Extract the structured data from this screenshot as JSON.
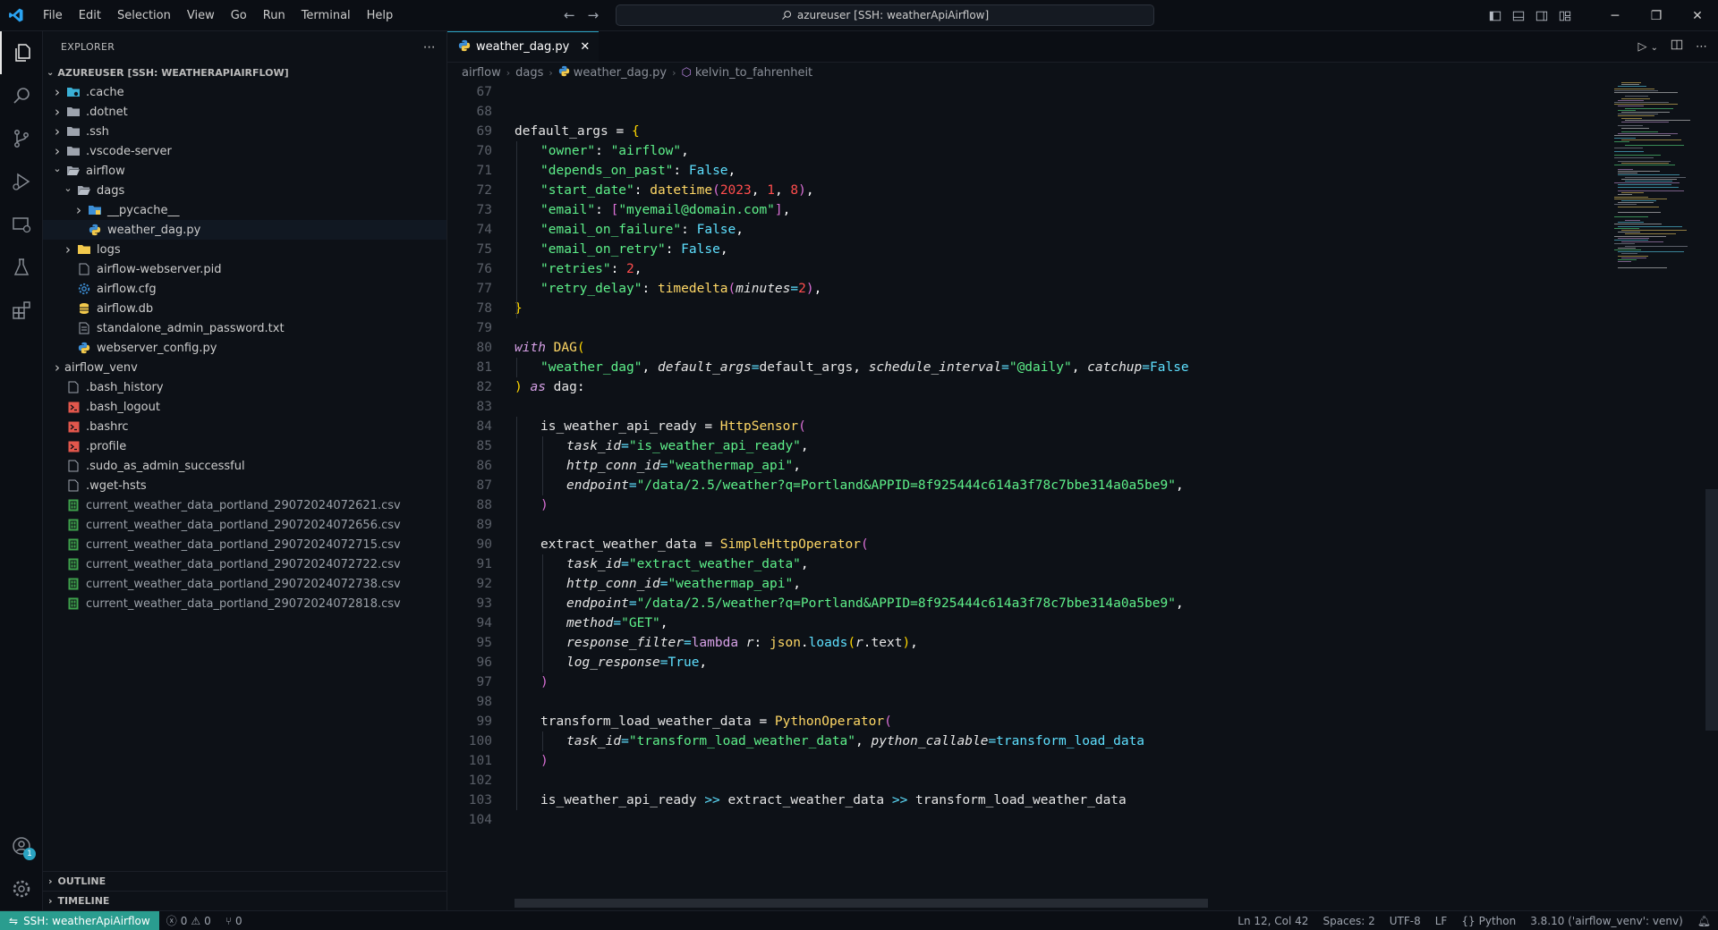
{
  "menu": [
    "File",
    "Edit",
    "Selection",
    "View",
    "Go",
    "Run",
    "Terminal",
    "Help"
  ],
  "search": {
    "text": "azureuser [SSH: weatherApiAirflow]"
  },
  "explorer": {
    "title": "EXPLORER",
    "root": "AZUREUSER [SSH: WEATHERAPIAIRFLOW]",
    "items": [
      {
        "label": ".cache",
        "depth": 1,
        "type": "folder",
        "chev": "right",
        "icon": "folder-cache-icon"
      },
      {
        "label": ".dotnet",
        "depth": 1,
        "type": "folder",
        "chev": "right",
        "icon": "folder-icon"
      },
      {
        "label": ".ssh",
        "depth": 1,
        "type": "folder",
        "chev": "right",
        "icon": "folder-icon"
      },
      {
        "label": ".vscode-server",
        "depth": 1,
        "type": "folder",
        "chev": "right",
        "icon": "folder-icon"
      },
      {
        "label": "airflow",
        "depth": 1,
        "type": "folder",
        "chev": "down",
        "icon": "folder-open-icon"
      },
      {
        "label": "dags",
        "depth": 2,
        "type": "folder",
        "chev": "down",
        "icon": "folder-open-icon"
      },
      {
        "label": "__pycache__",
        "depth": 3,
        "type": "folder",
        "chev": "right",
        "icon": "folder-python-icon"
      },
      {
        "label": "weather_dag.py",
        "depth": 3,
        "type": "file",
        "chev": "",
        "icon": "python-file-icon",
        "selected": true
      },
      {
        "label": "logs",
        "depth": 2,
        "type": "folder",
        "chev": "right",
        "icon": "folder-logs-icon"
      },
      {
        "label": "airflow-webserver.pid",
        "depth": 2,
        "type": "file",
        "chev": "",
        "icon": "file-icon"
      },
      {
        "label": "airflow.cfg",
        "depth": 2,
        "type": "file",
        "chev": "",
        "icon": "gear-file-icon"
      },
      {
        "label": "airflow.db",
        "depth": 2,
        "type": "file",
        "chev": "",
        "icon": "database-icon"
      },
      {
        "label": "standalone_admin_password.txt",
        "depth": 2,
        "type": "file",
        "chev": "",
        "icon": "text-file-icon"
      },
      {
        "label": "webserver_config.py",
        "depth": 2,
        "type": "file",
        "chev": "",
        "icon": "python-file-icon"
      },
      {
        "label": "airflow_venv",
        "depth": 1,
        "type": "folder",
        "chev": "right",
        "icon": ""
      },
      {
        "label": ".bash_history",
        "depth": 1,
        "type": "file",
        "chev": "",
        "icon": "file-icon"
      },
      {
        "label": ".bash_logout",
        "depth": 1,
        "type": "file",
        "chev": "",
        "icon": "shell-file-icon"
      },
      {
        "label": ".bashrc",
        "depth": 1,
        "type": "file",
        "chev": "",
        "icon": "shell-file-icon"
      },
      {
        "label": ".profile",
        "depth": 1,
        "type": "file",
        "chev": "",
        "icon": "shell-file-icon"
      },
      {
        "label": ".sudo_as_admin_successful",
        "depth": 1,
        "type": "file",
        "chev": "",
        "icon": "file-icon"
      },
      {
        "label": ".wget-hsts",
        "depth": 1,
        "type": "file",
        "chev": "",
        "icon": "file-icon"
      },
      {
        "label": "current_weather_data_portland_29072024072621.csv",
        "depth": 1,
        "type": "file",
        "chev": "",
        "icon": "csv-file-icon"
      },
      {
        "label": "current_weather_data_portland_29072024072656.csv",
        "depth": 1,
        "type": "file",
        "chev": "",
        "icon": "csv-file-icon"
      },
      {
        "label": "current_weather_data_portland_29072024072715.csv",
        "depth": 1,
        "type": "file",
        "chev": "",
        "icon": "csv-file-icon"
      },
      {
        "label": "current_weather_data_portland_29072024072722.csv",
        "depth": 1,
        "type": "file",
        "chev": "",
        "icon": "csv-file-icon"
      },
      {
        "label": "current_weather_data_portland_29072024072738.csv",
        "depth": 1,
        "type": "file",
        "chev": "",
        "icon": "csv-file-icon"
      },
      {
        "label": "current_weather_data_portland_29072024072818.csv",
        "depth": 1,
        "type": "file",
        "chev": "",
        "icon": "csv-file-icon"
      }
    ],
    "panels": [
      "OUTLINE",
      "TIMELINE"
    ]
  },
  "tab": {
    "label": "weather_dag.py"
  },
  "breadcrumbs": [
    "airflow",
    "dags",
    "weather_dag.py",
    "kelvin_to_fahrenheit"
  ],
  "code": [
    {
      "n": "67",
      "t": []
    },
    {
      "n": "68",
      "t": []
    },
    {
      "n": "69",
      "t": [
        [
          "ident",
          "default_args "
        ],
        [
          "k",
          "= "
        ],
        [
          "br",
          "{"
        ]
      ]
    },
    {
      "n": "70",
      "i": 1,
      "t": [
        [
          "str",
          "\"owner\""
        ],
        [
          "k",
          ": "
        ],
        [
          "str",
          "\"airflow\""
        ],
        [
          "k",
          ","
        ]
      ]
    },
    {
      "n": "71",
      "i": 1,
      "t": [
        [
          "str",
          "\"depends_on_past\""
        ],
        [
          "k",
          ": "
        ],
        [
          "bool",
          "False"
        ],
        [
          "k",
          ","
        ]
      ]
    },
    {
      "n": "72",
      "i": 1,
      "t": [
        [
          "str",
          "\"start_date\""
        ],
        [
          "k",
          ": "
        ],
        [
          "fn",
          "datetime"
        ],
        [
          "br2",
          "("
        ],
        [
          "num",
          "2023"
        ],
        [
          "k",
          ", "
        ],
        [
          "num",
          "1"
        ],
        [
          "k",
          ", "
        ],
        [
          "num",
          "8"
        ],
        [
          "br2",
          ")"
        ],
        [
          "k",
          ","
        ]
      ]
    },
    {
      "n": "73",
      "i": 1,
      "t": [
        [
          "str",
          "\"email\""
        ],
        [
          "k",
          ": "
        ],
        [
          "br2",
          "["
        ],
        [
          "str",
          "\"myemail@domain.com\""
        ],
        [
          "br2",
          "]"
        ],
        [
          "k",
          ","
        ]
      ]
    },
    {
      "n": "74",
      "i": 1,
      "t": [
        [
          "str",
          "\"email_on_failure\""
        ],
        [
          "k",
          ": "
        ],
        [
          "bool",
          "False"
        ],
        [
          "k",
          ","
        ]
      ]
    },
    {
      "n": "75",
      "i": 1,
      "t": [
        [
          "str",
          "\"email_on_retry\""
        ],
        [
          "k",
          ": "
        ],
        [
          "bool",
          "False"
        ],
        [
          "k",
          ","
        ]
      ]
    },
    {
      "n": "76",
      "i": 1,
      "t": [
        [
          "str",
          "\"retries\""
        ],
        [
          "k",
          ": "
        ],
        [
          "num",
          "2"
        ],
        [
          "k",
          ","
        ]
      ]
    },
    {
      "n": "77",
      "i": 1,
      "t": [
        [
          "str",
          "\"retry_delay\""
        ],
        [
          "k",
          ": "
        ],
        [
          "fn",
          "timedelta"
        ],
        [
          "br2",
          "("
        ],
        [
          "param",
          "minutes"
        ],
        [
          "op",
          "="
        ],
        [
          "num",
          "2"
        ],
        [
          "br2",
          ")"
        ],
        [
          "k",
          ","
        ]
      ]
    },
    {
      "n": "78",
      "t": [
        [
          "br",
          "}"
        ]
      ]
    },
    {
      "n": "79",
      "t": []
    },
    {
      "n": "80",
      "t": [
        [
          "kw",
          "with "
        ],
        [
          "cls",
          "DAG"
        ],
        [
          "br",
          "("
        ]
      ]
    },
    {
      "n": "81",
      "i": 1,
      "t": [
        [
          "str",
          "\"weather_dag\""
        ],
        [
          "k",
          ", "
        ],
        [
          "param",
          "default_args"
        ],
        [
          "op",
          "="
        ],
        [
          "ident",
          "default_args"
        ],
        [
          "k",
          ", "
        ],
        [
          "param",
          "schedule_interval"
        ],
        [
          "op",
          "="
        ],
        [
          "str",
          "\"@daily\""
        ],
        [
          "k",
          ", "
        ],
        [
          "param",
          "catchup"
        ],
        [
          "op",
          "="
        ],
        [
          "bool",
          "False"
        ]
      ]
    },
    {
      "n": "82",
      "t": [
        [
          "br",
          ")"
        ],
        [
          "kw",
          " as "
        ],
        [
          "ident",
          "dag"
        ],
        [
          "k",
          ":"
        ]
      ]
    },
    {
      "n": "83",
      "t": []
    },
    {
      "n": "84",
      "i": 1,
      "t": [
        [
          "ident",
          "is_weather_api_ready "
        ],
        [
          "k",
          "= "
        ],
        [
          "cls",
          "HttpSensor"
        ],
        [
          "br2",
          "("
        ]
      ]
    },
    {
      "n": "85",
      "i": 2,
      "t": [
        [
          "param",
          "task_id"
        ],
        [
          "op",
          "="
        ],
        [
          "str",
          "\"is_weather_api_ready\""
        ],
        [
          "k",
          ","
        ]
      ]
    },
    {
      "n": "86",
      "i": 2,
      "t": [
        [
          "param",
          "http_conn_id"
        ],
        [
          "op",
          "="
        ],
        [
          "str",
          "\"weathermap_api\""
        ],
        [
          "k",
          ","
        ]
      ]
    },
    {
      "n": "87",
      "i": 2,
      "t": [
        [
          "param",
          "endpoint"
        ],
        [
          "op",
          "="
        ],
        [
          "str",
          "\"/data/2.5/weather?q=Portland&APPID=8f925444c614a3f78c7bbe314a0a5be9\""
        ],
        [
          "k",
          ","
        ]
      ]
    },
    {
      "n": "88",
      "i": 1,
      "t": [
        [
          "br2",
          ")"
        ]
      ]
    },
    {
      "n": "89",
      "t": []
    },
    {
      "n": "90",
      "i": 1,
      "t": [
        [
          "ident",
          "extract_weather_data "
        ],
        [
          "k",
          "= "
        ],
        [
          "cls",
          "SimpleHttpOperator"
        ],
        [
          "br2",
          "("
        ]
      ]
    },
    {
      "n": "91",
      "i": 2,
      "t": [
        [
          "param",
          "task_id"
        ],
        [
          "op",
          "="
        ],
        [
          "str",
          "\"extract_weather_data\""
        ],
        [
          "k",
          ","
        ]
      ]
    },
    {
      "n": "92",
      "i": 2,
      "t": [
        [
          "param",
          "http_conn_id"
        ],
        [
          "op",
          "="
        ],
        [
          "str",
          "\"weathermap_api\""
        ],
        [
          "k",
          ","
        ]
      ]
    },
    {
      "n": "93",
      "i": 2,
      "t": [
        [
          "param",
          "endpoint"
        ],
        [
          "op",
          "="
        ],
        [
          "str",
          "\"/data/2.5/weather?q=Portland&APPID=8f925444c614a3f78c7bbe314a0a5be9\""
        ],
        [
          "k",
          ","
        ]
      ]
    },
    {
      "n": "94",
      "i": 2,
      "t": [
        [
          "param",
          "method"
        ],
        [
          "op",
          "="
        ],
        [
          "str",
          "\"GET\""
        ],
        [
          "k",
          ","
        ]
      ]
    },
    {
      "n": "95",
      "i": 2,
      "t": [
        [
          "param",
          "response_filter"
        ],
        [
          "op",
          "="
        ],
        [
          "lam",
          "lambda "
        ],
        [
          "param",
          "r"
        ],
        [
          "k",
          ": "
        ],
        [
          "fn",
          "json"
        ],
        [
          "k",
          "."
        ],
        [
          "call",
          "loads"
        ],
        [
          "br",
          "("
        ],
        [
          "param",
          "r"
        ],
        [
          "k",
          "."
        ],
        [
          "ident",
          "text"
        ],
        [
          "br",
          ")"
        ],
        [
          "k",
          ","
        ]
      ]
    },
    {
      "n": "96",
      "i": 2,
      "t": [
        [
          "param",
          "log_response"
        ],
        [
          "op",
          "="
        ],
        [
          "bool",
          "True"
        ],
        [
          "k",
          ","
        ]
      ]
    },
    {
      "n": "97",
      "i": 1,
      "t": [
        [
          "br2",
          ")"
        ]
      ]
    },
    {
      "n": "98",
      "t": []
    },
    {
      "n": "99",
      "i": 1,
      "t": [
        [
          "ident",
          "transform_load_weather_data "
        ],
        [
          "k",
          "= "
        ],
        [
          "cls",
          "PythonOperator"
        ],
        [
          "br2",
          "("
        ]
      ]
    },
    {
      "n": "100",
      "i": 2,
      "t": [
        [
          "param",
          "task_id"
        ],
        [
          "op",
          "="
        ],
        [
          "str",
          "\"transform_load_weather_data\""
        ],
        [
          "k",
          ", "
        ],
        [
          "param",
          "python_callable"
        ],
        [
          "op",
          "="
        ],
        [
          "call",
          "transform_load_data"
        ]
      ]
    },
    {
      "n": "101",
      "i": 1,
      "t": [
        [
          "br2",
          ")"
        ]
      ]
    },
    {
      "n": "102",
      "t": []
    },
    {
      "n": "103",
      "i": 1,
      "t": [
        [
          "ident",
          "is_weather_api_ready "
        ],
        [
          "op",
          ">>"
        ],
        [
          "ident",
          " extract_weather_data "
        ],
        [
          "op",
          ">>"
        ],
        [
          "ident",
          " transform_load_weather_data"
        ]
      ]
    },
    {
      "n": "104",
      "t": []
    }
  ],
  "status": {
    "remote": "SSH: weatherApiAirflow",
    "errors": "0",
    "warnings": "0",
    "ports": "0",
    "position": "Ln 12, Col 42",
    "spaces": "Spaces: 2",
    "encoding": "UTF-8",
    "eol": "LF",
    "language": "Python",
    "interpreter": "3.8.10 ('airflow_venv': venv)"
  },
  "account_badge": "1",
  "colors": {
    "accent": "#2aa3c2",
    "remote": "#2a9d8f"
  }
}
